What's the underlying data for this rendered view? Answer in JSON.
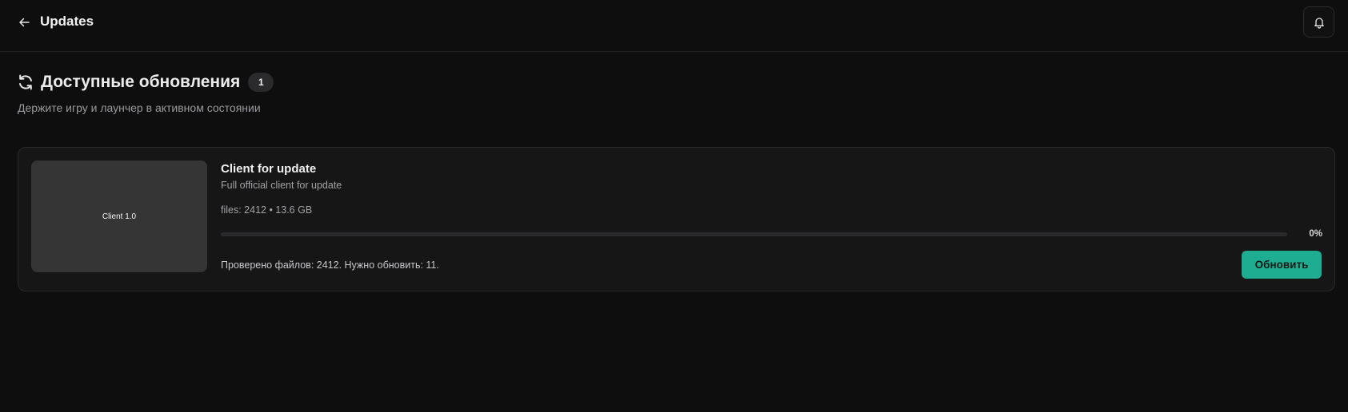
{
  "header": {
    "back_icon": "arrow-left-icon",
    "title": "Updates",
    "bell_icon": "bell-icon"
  },
  "section": {
    "icon": "refresh-icon",
    "title": "Доступные обновления",
    "count": "1",
    "subtitle": "Держите игру и лаунчер в активном состоянии"
  },
  "updates": [
    {
      "thumbnail_label": "Client 1.0",
      "title": "Client for update",
      "description": "Full official client for update",
      "meta": "files: 2412 • 13.6 GB",
      "progress_percent": 0,
      "progress_label": "0%",
      "status": "Проверено файлов: 2412. Нужно обновить: 11.",
      "action_label": "Обновить"
    }
  ],
  "colors": {
    "background": "#0e0e0f",
    "card": "#161617",
    "accent": "#1fad92"
  }
}
